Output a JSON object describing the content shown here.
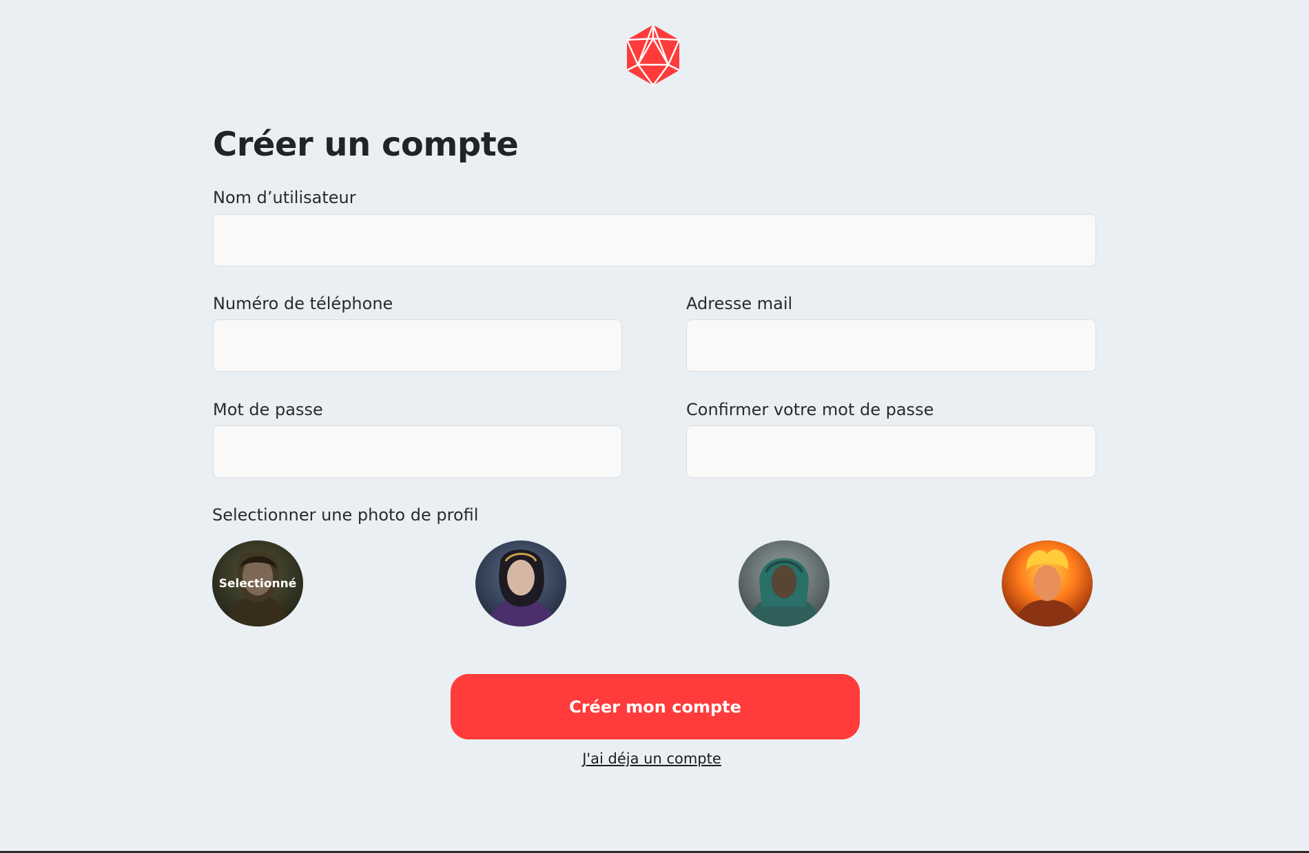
{
  "brand": {
    "logo_icon": "d20-icon",
    "accent_color": "#ff3b3b"
  },
  "form": {
    "title": "Créer un compte",
    "username": {
      "label": "Nom d’utilisateur",
      "value": "",
      "placeholder": ""
    },
    "phone": {
      "label": "Numéro de téléphone",
      "value": "",
      "placeholder": ""
    },
    "email": {
      "label": "Adresse mail",
      "value": "",
      "placeholder": ""
    },
    "password": {
      "label": "Mot de passe",
      "value": "",
      "placeholder": ""
    },
    "confirm_password": {
      "label": "Confirmer votre mot de passe",
      "value": "",
      "placeholder": ""
    },
    "avatar_section": {
      "label": "Selectionner une photo de profil",
      "selected_text": "Selectionné",
      "selected_index": 0,
      "options": [
        {
          "icon": "avatar-elf-icon",
          "selected": true
        },
        {
          "icon": "avatar-sorceress-icon",
          "selected": false
        },
        {
          "icon": "avatar-hooded-mage-icon",
          "selected": false
        },
        {
          "icon": "avatar-fire-mage-icon",
          "selected": false
        }
      ]
    },
    "submit_label": "Créer mon compte",
    "login_link": "J'ai déja un compte"
  }
}
